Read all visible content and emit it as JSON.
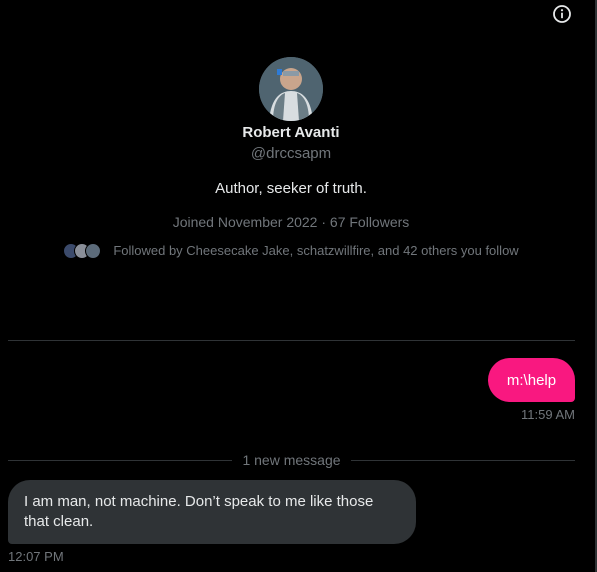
{
  "profile": {
    "name": "Robert Avanti",
    "handle": "@drccsapm",
    "bio": "Author, seeker of truth.",
    "meta": "Joined November 2022 · 67 Followers",
    "followed_by": "Followed by Cheesecake Jake, schatzwillfire, and 42 others you follow",
    "mini_avatar_colors": [
      "#3b4a6b",
      "#8a8f99",
      "#5c6b7a"
    ]
  },
  "messages": {
    "sent": {
      "text": "m:\\help",
      "time": "11:59 AM"
    },
    "divider_label": "1 new message",
    "received": {
      "text": "I am man, not machine. Don’t speak to me like those that clean.",
      "time": "12:07 PM"
    }
  },
  "icons": {
    "info": "info-circle-icon"
  },
  "colors": {
    "accent": "#f91880",
    "bubble_received": "#2f3336",
    "muted": "#71767b"
  }
}
